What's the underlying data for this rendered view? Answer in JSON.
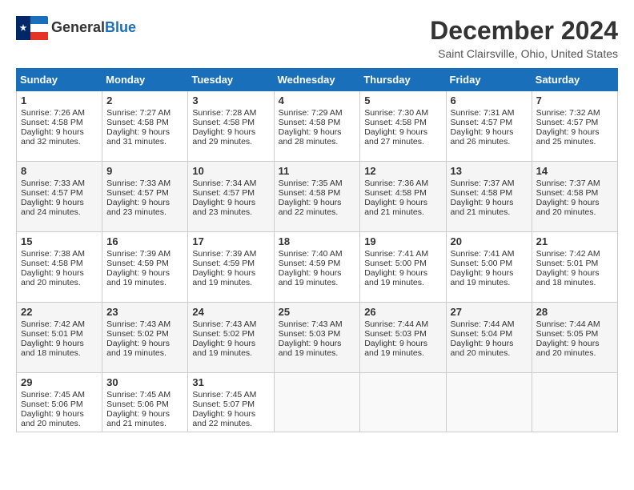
{
  "header": {
    "logo_general": "General",
    "logo_blue": "Blue",
    "month_title": "December 2024",
    "location": "Saint Clairsville, Ohio, United States"
  },
  "weekdays": [
    "Sunday",
    "Monday",
    "Tuesday",
    "Wednesday",
    "Thursday",
    "Friday",
    "Saturday"
  ],
  "weeks": [
    [
      {
        "day": "1",
        "sunrise": "Sunrise: 7:26 AM",
        "sunset": "Sunset: 4:58 PM",
        "daylight": "Daylight: 9 hours and 32 minutes."
      },
      {
        "day": "2",
        "sunrise": "Sunrise: 7:27 AM",
        "sunset": "Sunset: 4:58 PM",
        "daylight": "Daylight: 9 hours and 31 minutes."
      },
      {
        "day": "3",
        "sunrise": "Sunrise: 7:28 AM",
        "sunset": "Sunset: 4:58 PM",
        "daylight": "Daylight: 9 hours and 29 minutes."
      },
      {
        "day": "4",
        "sunrise": "Sunrise: 7:29 AM",
        "sunset": "Sunset: 4:58 PM",
        "daylight": "Daylight: 9 hours and 28 minutes."
      },
      {
        "day": "5",
        "sunrise": "Sunrise: 7:30 AM",
        "sunset": "Sunset: 4:58 PM",
        "daylight": "Daylight: 9 hours and 27 minutes."
      },
      {
        "day": "6",
        "sunrise": "Sunrise: 7:31 AM",
        "sunset": "Sunset: 4:57 PM",
        "daylight": "Daylight: 9 hours and 26 minutes."
      },
      {
        "day": "7",
        "sunrise": "Sunrise: 7:32 AM",
        "sunset": "Sunset: 4:57 PM",
        "daylight": "Daylight: 9 hours and 25 minutes."
      }
    ],
    [
      {
        "day": "8",
        "sunrise": "Sunrise: 7:33 AM",
        "sunset": "Sunset: 4:57 PM",
        "daylight": "Daylight: 9 hours and 24 minutes."
      },
      {
        "day": "9",
        "sunrise": "Sunrise: 7:33 AM",
        "sunset": "Sunset: 4:57 PM",
        "daylight": "Daylight: 9 hours and 23 minutes."
      },
      {
        "day": "10",
        "sunrise": "Sunrise: 7:34 AM",
        "sunset": "Sunset: 4:57 PM",
        "daylight": "Daylight: 9 hours and 23 minutes."
      },
      {
        "day": "11",
        "sunrise": "Sunrise: 7:35 AM",
        "sunset": "Sunset: 4:58 PM",
        "daylight": "Daylight: 9 hours and 22 minutes."
      },
      {
        "day": "12",
        "sunrise": "Sunrise: 7:36 AM",
        "sunset": "Sunset: 4:58 PM",
        "daylight": "Daylight: 9 hours and 21 minutes."
      },
      {
        "day": "13",
        "sunrise": "Sunrise: 7:37 AM",
        "sunset": "Sunset: 4:58 PM",
        "daylight": "Daylight: 9 hours and 21 minutes."
      },
      {
        "day": "14",
        "sunrise": "Sunrise: 7:37 AM",
        "sunset": "Sunset: 4:58 PM",
        "daylight": "Daylight: 9 hours and 20 minutes."
      }
    ],
    [
      {
        "day": "15",
        "sunrise": "Sunrise: 7:38 AM",
        "sunset": "Sunset: 4:58 PM",
        "daylight": "Daylight: 9 hours and 20 minutes."
      },
      {
        "day": "16",
        "sunrise": "Sunrise: 7:39 AM",
        "sunset": "Sunset: 4:59 PM",
        "daylight": "Daylight: 9 hours and 19 minutes."
      },
      {
        "day": "17",
        "sunrise": "Sunrise: 7:39 AM",
        "sunset": "Sunset: 4:59 PM",
        "daylight": "Daylight: 9 hours and 19 minutes."
      },
      {
        "day": "18",
        "sunrise": "Sunrise: 7:40 AM",
        "sunset": "Sunset: 4:59 PM",
        "daylight": "Daylight: 9 hours and 19 minutes."
      },
      {
        "day": "19",
        "sunrise": "Sunrise: 7:41 AM",
        "sunset": "Sunset: 5:00 PM",
        "daylight": "Daylight: 9 hours and 19 minutes."
      },
      {
        "day": "20",
        "sunrise": "Sunrise: 7:41 AM",
        "sunset": "Sunset: 5:00 PM",
        "daylight": "Daylight: 9 hours and 19 minutes."
      },
      {
        "day": "21",
        "sunrise": "Sunrise: 7:42 AM",
        "sunset": "Sunset: 5:01 PM",
        "daylight": "Daylight: 9 hours and 18 minutes."
      }
    ],
    [
      {
        "day": "22",
        "sunrise": "Sunrise: 7:42 AM",
        "sunset": "Sunset: 5:01 PM",
        "daylight": "Daylight: 9 hours and 18 minutes."
      },
      {
        "day": "23",
        "sunrise": "Sunrise: 7:43 AM",
        "sunset": "Sunset: 5:02 PM",
        "daylight": "Daylight: 9 hours and 19 minutes."
      },
      {
        "day": "24",
        "sunrise": "Sunrise: 7:43 AM",
        "sunset": "Sunset: 5:02 PM",
        "daylight": "Daylight: 9 hours and 19 minutes."
      },
      {
        "day": "25",
        "sunrise": "Sunrise: 7:43 AM",
        "sunset": "Sunset: 5:03 PM",
        "daylight": "Daylight: 9 hours and 19 minutes."
      },
      {
        "day": "26",
        "sunrise": "Sunrise: 7:44 AM",
        "sunset": "Sunset: 5:03 PM",
        "daylight": "Daylight: 9 hours and 19 minutes."
      },
      {
        "day": "27",
        "sunrise": "Sunrise: 7:44 AM",
        "sunset": "Sunset: 5:04 PM",
        "daylight": "Daylight: 9 hours and 20 minutes."
      },
      {
        "day": "28",
        "sunrise": "Sunrise: 7:44 AM",
        "sunset": "Sunset: 5:05 PM",
        "daylight": "Daylight: 9 hours and 20 minutes."
      }
    ],
    [
      {
        "day": "29",
        "sunrise": "Sunrise: 7:45 AM",
        "sunset": "Sunset: 5:06 PM",
        "daylight": "Daylight: 9 hours and 20 minutes."
      },
      {
        "day": "30",
        "sunrise": "Sunrise: 7:45 AM",
        "sunset": "Sunset: 5:06 PM",
        "daylight": "Daylight: 9 hours and 21 minutes."
      },
      {
        "day": "31",
        "sunrise": "Sunrise: 7:45 AM",
        "sunset": "Sunset: 5:07 PM",
        "daylight": "Daylight: 9 hours and 22 minutes."
      },
      null,
      null,
      null,
      null
    ]
  ]
}
